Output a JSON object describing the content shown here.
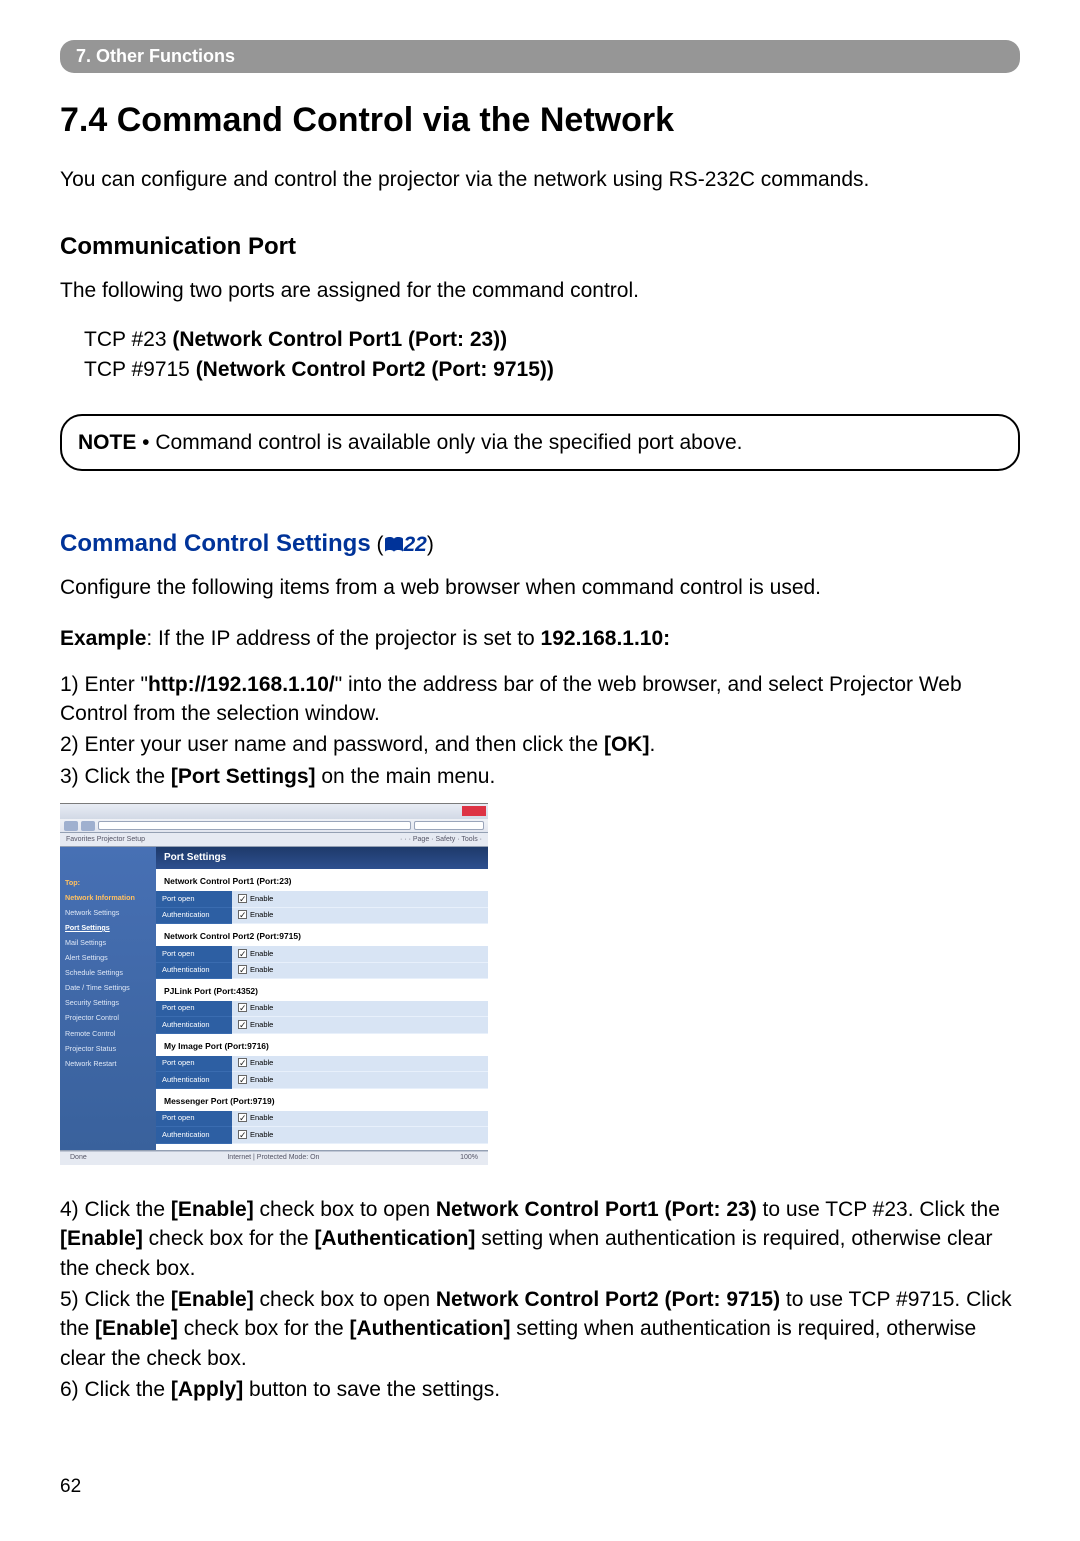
{
  "breadcrumb": "7. Other Functions",
  "h1": "7.4 Command Control via the Network",
  "intro": "You can configure and control the projector via the network using RS-232C commands.",
  "comm_port_heading": "Communication Port",
  "comm_port_text": "The following two ports are assigned for the command control.",
  "port1_prefix": "TCP #23 ",
  "port1_bold": "(Network Control Port1 (Port: 23))",
  "port2_prefix": "TCP #9715 ",
  "port2_bold": "(Network Control Port2 (Port: 9715))",
  "note_label": "NOTE",
  "note_text": " • Command control is available only via the specified port above.",
  "settings_title": "Command Control Settings",
  "settings_ref": "22",
  "settings_paren_open": " (",
  "settings_paren_close": ")",
  "configure_text": "Configure the following items from a web browser when command control is used.",
  "example_label": "Example",
  "example_text": ": If the IP address of the projector is set to ",
  "example_ip": "192.168.1.10:",
  "step1_a": "1) Enter \"",
  "step1_url": "http://192.168.1.10/",
  "step1_b": "\" into the address bar of the web browser, and select Projector Web Control from the selection window.",
  "step2_a": "2) Enter your user name and password, and then click the ",
  "step2_b": "[OK]",
  "step2_c": ".",
  "step3_a": "3) Click the ",
  "step3_b": "[Port Settings]",
  "step3_c": " on the main menu.",
  "screenshot": {
    "tabs_left": "Favorites  Projector Setup",
    "tabs_right": "   ·    ·    · Page · Safety · Tools · ",
    "sidebar": {
      "top": "Top:",
      "network_info": "Network Information",
      "network_settings": "Network Settings",
      "port_settings": "Port Settings",
      "mail_settings": "Mail Settings",
      "alert_settings": "Alert Settings",
      "schedule_settings": "Schedule Settings",
      "datetime_settings": "Date / Time Settings",
      "security_settings": "Security Settings",
      "projector_control": "Projector Control",
      "remote_control": "Remote Control",
      "projector_status": "Projector Status",
      "network_restart": "Network Restart"
    },
    "panel_title": "Port Settings",
    "sections": {
      "s1": "Network Control Port1 (Port:23)",
      "s2": "Network Control Port2 (Port:9715)",
      "s3": "PJLink Port (Port:4352)",
      "s4": "My Image Port (Port:9716)",
      "s5": "Messenger Port (Port:9719)"
    },
    "row_labels": {
      "port_open": "Port open",
      "authentication": "Authentication"
    },
    "row_value": "Enable",
    "status_left": "Done",
    "status_center": "Internet | Protected Mode: On",
    "status_right": "100%"
  },
  "step4_a": "4) Click the ",
  "step4_b": "[Enable]",
  "step4_c": " check box to open ",
  "step4_d": "Network Control Port1 (Port: 23)",
  "step4_e": " to use TCP #23. Click the ",
  "step4_f": "[Enable]",
  "step4_g": " check box for the ",
  "step4_h": "[Authentication]",
  "step4_i": " setting when authentication is required, otherwise clear the check box.",
  "step5_a": "5) Click the ",
  "step5_b": "[Enable]",
  "step5_c": " check box to open ",
  "step5_d": "Network Control Port2 (Port: 9715)",
  "step5_e": " to use TCP #9715. Click the ",
  "step5_f": "[Enable]",
  "step5_g": " check box for the ",
  "step5_h": "[Authentication]",
  "step5_i": " setting when authentication is required, otherwise clear the check box.",
  "step6_a": "6) Click the ",
  "step6_b": "[Apply]",
  "step6_c": " button to save the settings.",
  "page_num": "62"
}
